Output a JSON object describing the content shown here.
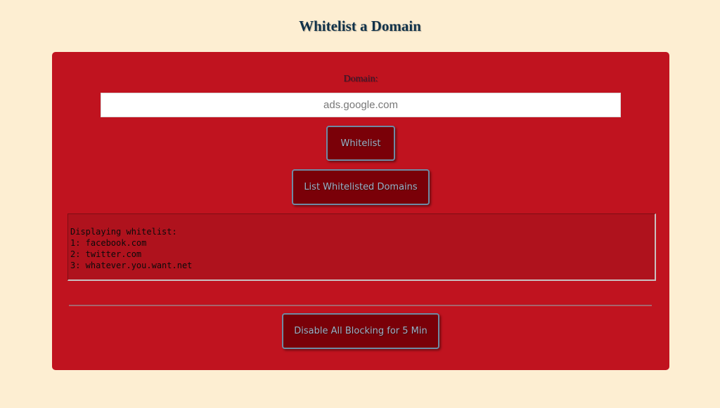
{
  "page": {
    "title": "Whitelist a Domain"
  },
  "form": {
    "domain_label": "Domain:",
    "domain_placeholder": "ads.google.com",
    "domain_value": "",
    "whitelist_button": "Whitelist",
    "list_button": "List Whitelisted Domains"
  },
  "output": {
    "lines": [
      "Displaying whitelist:",
      "1: facebook.com",
      "2: twitter.com",
      "3: whatever.you.want.net"
    ]
  },
  "footer": {
    "disable_button": "Disable All Blocking for 5 Min"
  },
  "colors": {
    "background": "#fdeed2",
    "panel": "#c0131f",
    "button": "#7a0008",
    "button_text": "#9ab2c8",
    "title": "#10324a"
  }
}
